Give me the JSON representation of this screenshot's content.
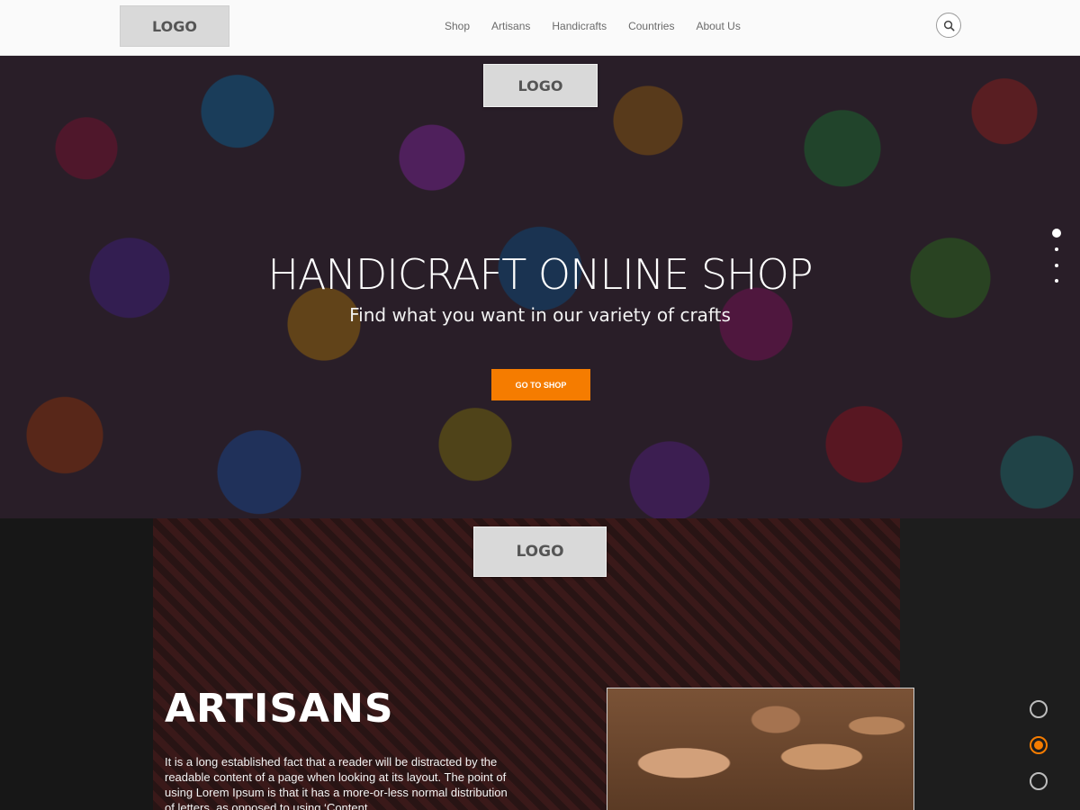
{
  "navbar": {
    "logo": "LOGO",
    "links": [
      "Shop",
      "Artisans",
      "Handicrafts",
      "Countries",
      "About Us"
    ],
    "search_icon": "search-icon"
  },
  "hero": {
    "logo": "LOGO",
    "title": "HANDICRAFT ONLINE SHOP",
    "subtitle": "Find what you want in our variety of crafts",
    "cta_label": "GO TO SHOP",
    "accent_color": "#f57c00",
    "slide_indicators": 4,
    "active_slide": 1
  },
  "artisans": {
    "logo": "LOGO",
    "title": "ARTISANS",
    "text": "It is a long established fact that a reader will be distracted by the readable content of a page when looking at its layout. The point of using Lorem Ipsum is that it has a more-or-less normal distribution of letters, as opposed to using ‘Content",
    "section_indicators": 3,
    "active_section": 2
  }
}
